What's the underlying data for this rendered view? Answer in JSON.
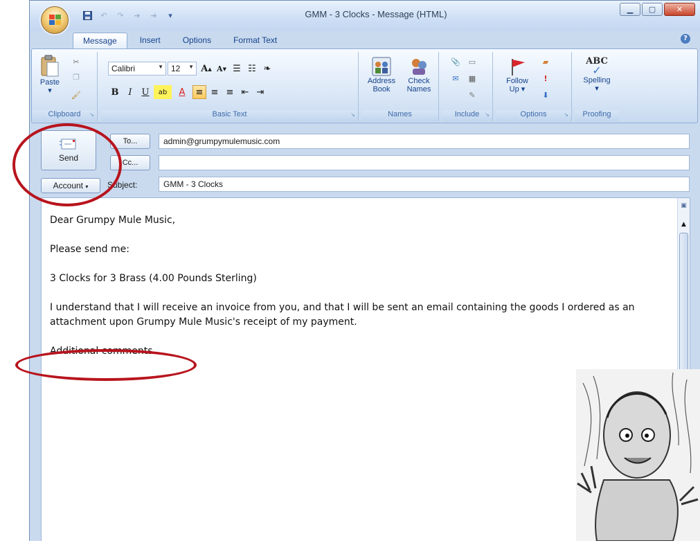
{
  "window": {
    "title": "GMM - 3 Clocks - Message (HTML)"
  },
  "quick_access": {
    "items": [
      "save-icon",
      "undo-icon",
      "redo-icon",
      "up-icon",
      "down-icon",
      "customize-icon"
    ]
  },
  "tabs": [
    {
      "label": "Message",
      "active": true
    },
    {
      "label": "Insert",
      "active": false
    },
    {
      "label": "Options",
      "active": false
    },
    {
      "label": "Format Text",
      "active": false
    }
  ],
  "ribbon": {
    "clipboard": {
      "group_label": "Clipboard",
      "paste_label": "Paste"
    },
    "basic_text": {
      "group_label": "Basic Text",
      "font_name": "Calibri",
      "font_size": "12"
    },
    "names": {
      "group_label": "Names",
      "address_book_label_1": "Address",
      "address_book_label_2": "Book",
      "check_names_label_1": "Check",
      "check_names_label_2": "Names"
    },
    "include": {
      "group_label": "Include"
    },
    "options": {
      "group_label": "Options",
      "follow_up_label_1": "Follow",
      "follow_up_label_2": "Up ▾"
    },
    "proofing": {
      "group_label": "Proofing",
      "spelling_label": "Spelling",
      "abc": "ABC"
    }
  },
  "header": {
    "send_label": "Send",
    "to_button": "To...",
    "cc_button": "Cc...",
    "account_button": "Account",
    "subject_label": "Subject:",
    "to_value": "admin@grumpymulemusic.com",
    "cc_value": "",
    "subject_value": "GMM - 3 Clocks"
  },
  "body": {
    "greeting": "Dear Grumpy Mule Music,",
    "line1": "Please send me:",
    "line2": "3 Clocks for 3 Brass (4.00 Pounds Sterling)",
    "line3": "I understand that I will receive an invoice from you, and that I will be sent an email containing the goods I ordered as an attachment upon Grumpy Mule Music's receipt of my payment.",
    "line4": "Additional comments..."
  },
  "colors": {
    "annotation_ring": "#b8141d",
    "ribbon_blue": "#15428b",
    "window_frame": "#c9daef"
  }
}
